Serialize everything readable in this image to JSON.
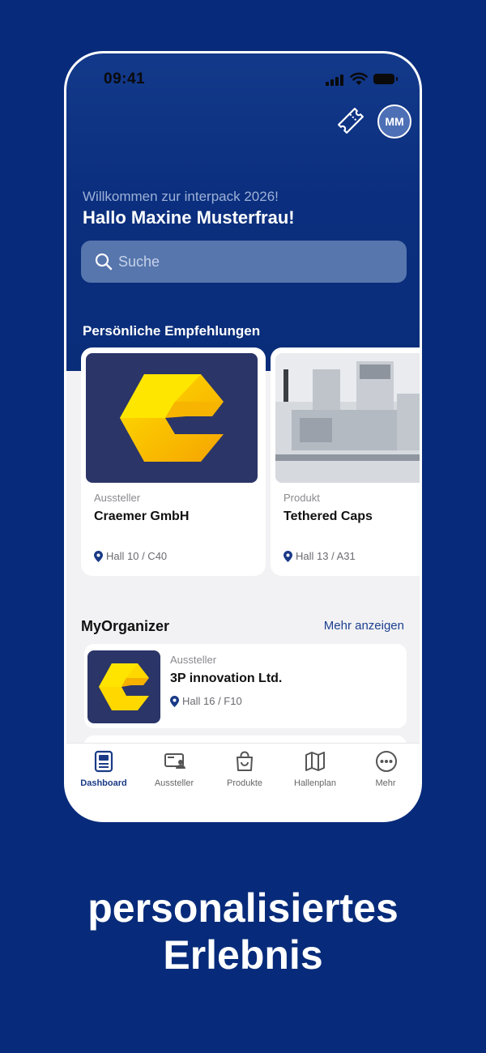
{
  "status_bar": {
    "time": "09:41"
  },
  "header": {
    "avatar_initials": "MM",
    "welcome": "Willkommen zur interpack 2026!",
    "greeting": "Hallo Maxine Musterfrau!"
  },
  "search": {
    "placeholder": "Suche"
  },
  "recommendations": {
    "title": "Persönliche Empfehlungen",
    "items": [
      {
        "type": "Aussteller",
        "name": "Craemer GmbH",
        "location": "Hall 10 / C40"
      },
      {
        "type": "Produkt",
        "name": "Tethered Caps",
        "location": "Hall 13 / A31"
      }
    ]
  },
  "organizer": {
    "title": "MyOrganizer",
    "more": "Mehr anzeigen",
    "items": [
      {
        "type": "Aussteller",
        "name": "3P innovation Ltd.",
        "location": "Hall 16 / F10"
      }
    ]
  },
  "tabs": [
    {
      "label": "Dashboard",
      "icon": "dashboard-icon",
      "active": true
    },
    {
      "label": "Aussteller",
      "icon": "exhibitor-icon"
    },
    {
      "label": "Produkte",
      "icon": "shopping-bag-icon"
    },
    {
      "label": "Hallenplan",
      "icon": "map-icon"
    },
    {
      "label": "Mehr",
      "icon": "more-icon"
    }
  ],
  "tagline": {
    "line1": "personalisiertes",
    "line2": "Erlebnis"
  },
  "colors": {
    "background": "#072b7a",
    "accent": "#1a3a86",
    "logo_yellow": "#ffd200"
  }
}
